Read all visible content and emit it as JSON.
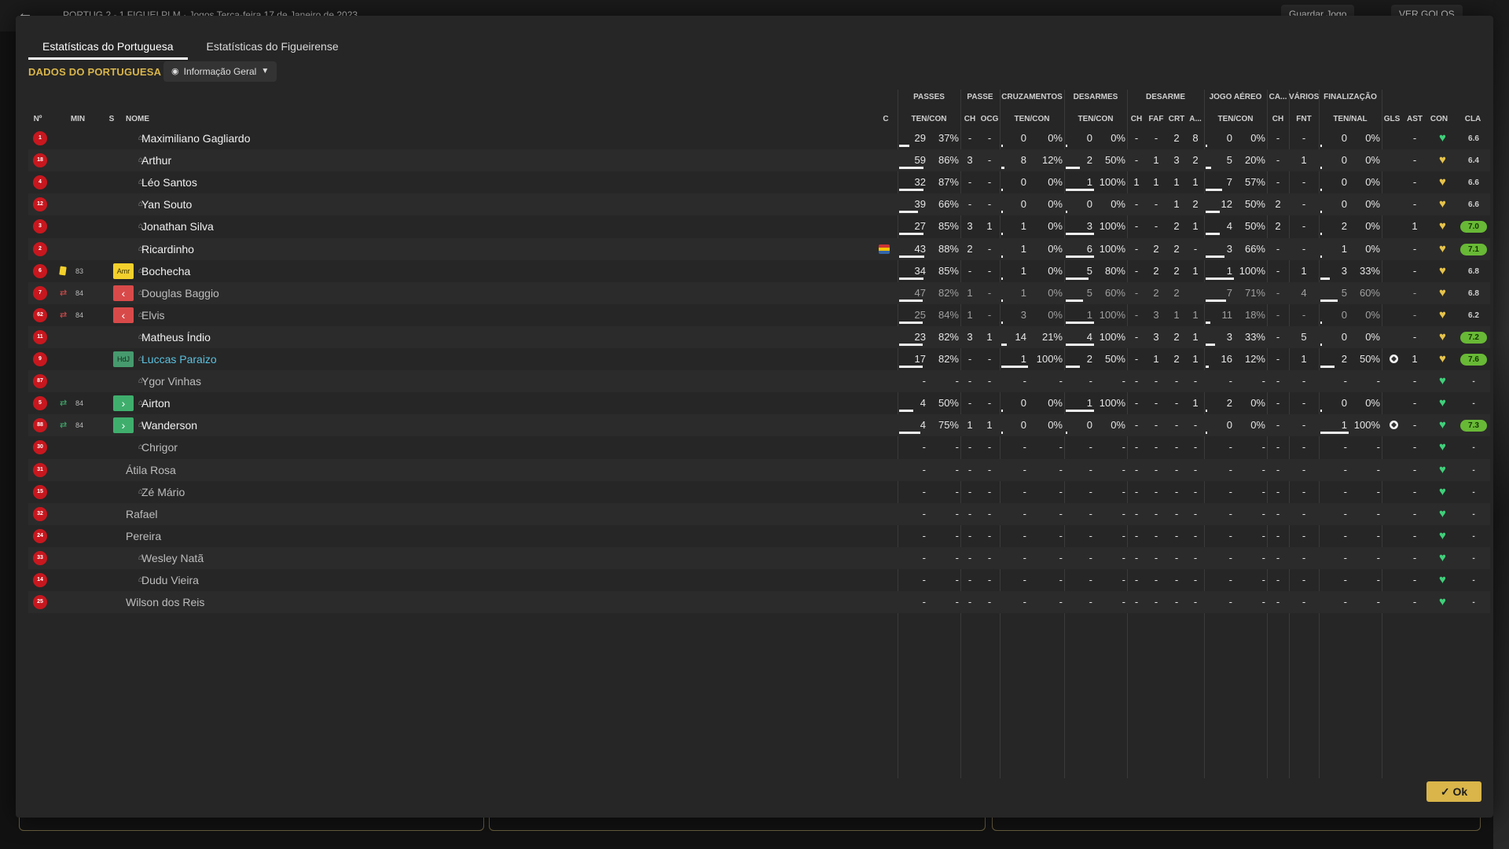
{
  "header": {
    "back_icon": "back-arrow-icon",
    "match_text": "PORTUG  2 - 1  FIGUEI  PLM · Jogos       Terça-feira 17 de Janeiro de 2023",
    "save_label": "Guardar Jogo",
    "goals_label": "VER GOLOS"
  },
  "tabs": [
    {
      "label": "Estatísticas do Portuguesa"
    },
    {
      "label": "Estatísticas do Figueirense"
    }
  ],
  "section_title": "DADOS DO PORTUGUESA",
  "dropdown": {
    "label": "Informação Geral",
    "icon": "eye-icon"
  },
  "groups": {
    "passes": "PASSES",
    "passe": "PASSE",
    "cruzamentos": "CRUZAMENTOS",
    "desarmes": "DESARMES",
    "desarme": "DESARME",
    "jogo_aereo": "JOGO AÉREO",
    "ca": "CA...",
    "varios": "VÁRIOS",
    "finalizacao": "FINALIZAÇÃO"
  },
  "columns": {
    "num": "Nº",
    "min": "MIN",
    "s": "S",
    "nome": "NOME",
    "c": "C",
    "passes_tc": "TEN/CON",
    "passe_ch": "CH",
    "passe_ocg": "OCG",
    "cruz_tc": "TEN/CON",
    "des_tc": "TEN/CON",
    "de_ch": "CH",
    "de_faf": "FAF",
    "de_crt": "CRT",
    "de_a": "A...",
    "aer_tc": "TEN/CON",
    "ca_ch": "CH",
    "fnt": "FNT",
    "fin_tn": "TEN/NAL",
    "gls": "GLS",
    "ast": "AST",
    "con": "CON",
    "cla": "CLA"
  },
  "rating_color": "#68b936",
  "players": [
    {
      "num": "1",
      "name": "Maximiliano Gagliardo",
      "ps": "29",
      "psp": "37%",
      "ch": "-",
      "ocg": "-",
      "cr": "0",
      "crp": "0%",
      "ds": "0",
      "dsp": "0%",
      "dch": "-",
      "faf": "-",
      "crt": "2",
      "da": "8",
      "ae": "0",
      "aep": "0%",
      "cach": "-",
      "fnt": "-",
      "fn": "0",
      "fnp": "0%",
      "gls": "",
      "ast": "-",
      "con": "green",
      "cla": "6.6"
    },
    {
      "num": "18",
      "name": "Arthur",
      "ps": "59",
      "psp": "86%",
      "ch": "3",
      "ocg": "-",
      "cr": "8",
      "crp": "12%",
      "ds": "2",
      "dsp": "50%",
      "dch": "-",
      "faf": "1",
      "crt": "3",
      "da": "2",
      "ae": "5",
      "aep": "20%",
      "cach": "-",
      "fnt": "1",
      "fn": "0",
      "fnp": "0%",
      "gls": "",
      "ast": "-",
      "con": "yellow",
      "cla": "6.4"
    },
    {
      "num": "4",
      "name": "Léo Santos",
      "ps": "32",
      "psp": "87%",
      "ch": "-",
      "ocg": "-",
      "cr": "0",
      "crp": "0%",
      "ds": "1",
      "dsp": "100%",
      "dch": "1",
      "faf": "1",
      "crt": "1",
      "da": "1",
      "ae": "7",
      "aep": "57%",
      "cach": "-",
      "fnt": "-",
      "fn": "0",
      "fnp": "0%",
      "gls": "",
      "ast": "-",
      "con": "yellow",
      "cla": "6.6"
    },
    {
      "num": "12",
      "name": "Yan Souto",
      "ps": "39",
      "psp": "66%",
      "ch": "-",
      "ocg": "-",
      "cr": "0",
      "crp": "0%",
      "ds": "0",
      "dsp": "0%",
      "dch": "-",
      "faf": "-",
      "crt": "1",
      "da": "2",
      "ae": "12",
      "aep": "50%",
      "cach": "2",
      "fnt": "-",
      "fn": "0",
      "fnp": "0%",
      "gls": "",
      "ast": "-",
      "con": "yellow",
      "cla": "6.6"
    },
    {
      "num": "3",
      "name": "Jonathan Silva",
      "ps": "27",
      "psp": "85%",
      "ch": "3",
      "ocg": "1",
      "cr": "1",
      "crp": "0%",
      "ds": "3",
      "dsp": "100%",
      "dch": "-",
      "faf": "-",
      "crt": "2",
      "da": "1",
      "ae": "4",
      "aep": "50%",
      "cach": "2",
      "fnt": "-",
      "fn": "2",
      "fnp": "0%",
      "gls": "",
      "ast": "1",
      "con": "yellow",
      "cla": "7.0"
    },
    {
      "num": "2",
      "name": "Ricardinho",
      "ps": "43",
      "psp": "88%",
      "ch": "2",
      "ocg": "-",
      "cr": "1",
      "crp": "0%",
      "ds": "6",
      "dsp": "100%",
      "dch": "-",
      "faf": "2",
      "crt": "2",
      "da": "-",
      "ae": "3",
      "aep": "66%",
      "cach": "-",
      "fnt": "-",
      "fn": "1",
      "fnp": "0%",
      "gls": "",
      "ast": "-",
      "con": "yellow",
      "cla": "7.1",
      "flag": true
    },
    {
      "num": "6",
      "name": "Bochecha",
      "min": "83",
      "badge": "Amr",
      "card": "yellow",
      "ps": "34",
      "psp": "85%",
      "ch": "-",
      "ocg": "-",
      "cr": "1",
      "crp": "0%",
      "ds": "5",
      "dsp": "80%",
      "dch": "-",
      "faf": "2",
      "crt": "2",
      "da": "1",
      "ae": "1",
      "aep": "100%",
      "cach": "-",
      "fnt": "1",
      "fn": "3",
      "fnp": "33%",
      "gls": "",
      "ast": "-",
      "con": "yellow",
      "cla": "6.8"
    },
    {
      "num": "7",
      "name": "Douglas Baggio",
      "min": "84",
      "badge": "‹",
      "sub": "out",
      "ps": "47",
      "psp": "82%",
      "ch": "1",
      "ocg": "-",
      "cr": "1",
      "crp": "0%",
      "ds": "5",
      "dsp": "60%",
      "dch": "-",
      "faf": "2",
      "crt": "2",
      "da": "",
      "ae": "7",
      "aep": "71%",
      "cach": "-",
      "fnt": "4",
      "fn": "5",
      "fnp": "60%",
      "gls": "",
      "ast": "-",
      "con": "yellow",
      "cla": "6.8"
    },
    {
      "num": "62",
      "name": "Elvis",
      "min": "84",
      "badge": "‹",
      "sub": "out",
      "ps": "25",
      "psp": "84%",
      "ch": "1",
      "ocg": "-",
      "cr": "3",
      "crp": "0%",
      "ds": "1",
      "dsp": "100%",
      "dch": "-",
      "faf": "3",
      "crt": "1",
      "da": "1",
      "ae": "11",
      "aep": "18%",
      "cach": "-",
      "fnt": "-",
      "fn": "0",
      "fnp": "0%",
      "gls": "",
      "ast": "-",
      "con": "yellow",
      "cla": "6.2"
    },
    {
      "num": "11",
      "name": "Matheus Índio",
      "ps": "23",
      "psp": "82%",
      "ch": "3",
      "ocg": "1",
      "cr": "14",
      "crp": "21%",
      "ds": "4",
      "dsp": "100%",
      "dch": "-",
      "faf": "3",
      "crt": "2",
      "da": "1",
      "ae": "3",
      "aep": "33%",
      "cach": "-",
      "fnt": "5",
      "fn": "0",
      "fnp": "0%",
      "gls": "",
      "ast": "-",
      "con": "yellow",
      "cla": "7.2"
    },
    {
      "num": "9",
      "name": "Luccas Paraizo",
      "badge": "HdJ",
      "ps": "17",
      "psp": "82%",
      "ch": "-",
      "ocg": "-",
      "cr": "1",
      "crp": "100%",
      "ds": "2",
      "dsp": "50%",
      "dch": "-",
      "faf": "1",
      "crt": "2",
      "da": "1",
      "ae": "16",
      "aep": "12%",
      "cach": "-",
      "fnt": "1",
      "fn": "2",
      "fnp": "50%",
      "gls": "ball",
      "ast": "1",
      "con": "yellow",
      "cla": "7.6"
    },
    {
      "num": "87",
      "name": "Ygor Vinhas",
      "ps": "-",
      "psp": "-",
      "ch": "-",
      "ocg": "-",
      "cr": "-",
      "crp": "-",
      "ds": "-",
      "dsp": "-",
      "dch": "-",
      "faf": "-",
      "crt": "-",
      "da": "-",
      "ae": "-",
      "aep": "-",
      "cach": "-",
      "fnt": "-",
      "fn": "-",
      "fnp": "-",
      "gls": "",
      "ast": "-",
      "con": "green",
      "cla": "-"
    },
    {
      "num": "5",
      "name": "Airton",
      "min": "84",
      "badge": "›",
      "sub": "in",
      "ps": "4",
      "psp": "50%",
      "ch": "-",
      "ocg": "-",
      "cr": "0",
      "crp": "0%",
      "ds": "1",
      "dsp": "100%",
      "dch": "-",
      "faf": "-",
      "crt": "-",
      "da": "1",
      "ae": "2",
      "aep": "0%",
      "cach": "-",
      "fnt": "-",
      "fn": "0",
      "fnp": "0%",
      "gls": "",
      "ast": "-",
      "con": "green",
      "cla": "-"
    },
    {
      "num": "88",
      "name": "Wanderson",
      "min": "84",
      "badge": "›",
      "sub": "in",
      "ps": "4",
      "psp": "75%",
      "ch": "1",
      "ocg": "1",
      "cr": "0",
      "crp": "0%",
      "ds": "0",
      "dsp": "0%",
      "dch": "-",
      "faf": "-",
      "crt": "-",
      "da": "-",
      "ae": "0",
      "aep": "0%",
      "cach": "-",
      "fnt": "-",
      "fn": "1",
      "fnp": "100%",
      "gls": "ball",
      "ast": "-",
      "con": "green",
      "cla": "7.3"
    },
    {
      "num": "30",
      "name": "Chrigor",
      "ps": "-",
      "psp": "-",
      "ch": "-",
      "ocg": "-",
      "cr": "-",
      "crp": "-",
      "ds": "-",
      "dsp": "-",
      "dch": "-",
      "faf": "-",
      "crt": "-",
      "da": "-",
      "ae": "-",
      "aep": "-",
      "cach": "-",
      "fnt": "-",
      "fn": "-",
      "fnp": "-",
      "gls": "",
      "ast": "-",
      "con": "green",
      "cla": "-"
    },
    {
      "num": "31",
      "name": "Átila Rosa",
      "ps": "-",
      "psp": "-",
      "ch": "-",
      "ocg": "-",
      "cr": "-",
      "crp": "-",
      "ds": "-",
      "dsp": "-",
      "dch": "-",
      "faf": "-",
      "crt": "-",
      "da": "-",
      "ae": "-",
      "aep": "-",
      "cach": "-",
      "fnt": "-",
      "fn": "-",
      "fnp": "-",
      "gls": "",
      "ast": "-",
      "con": "green",
      "cla": "-"
    },
    {
      "num": "15",
      "name": "Zé Mário",
      "ps": "-",
      "psp": "-",
      "ch": "-",
      "ocg": "-",
      "cr": "-",
      "crp": "-",
      "ds": "-",
      "dsp": "-",
      "dch": "-",
      "faf": "-",
      "crt": "-",
      "da": "-",
      "ae": "-",
      "aep": "-",
      "cach": "-",
      "fnt": "-",
      "fn": "-",
      "fnp": "-",
      "gls": "",
      "ast": "-",
      "con": "green",
      "cla": "-"
    },
    {
      "num": "32",
      "name": "Rafael",
      "ps": "-",
      "psp": "-",
      "ch": "-",
      "ocg": "-",
      "cr": "-",
      "crp": "-",
      "ds": "-",
      "dsp": "-",
      "dch": "-",
      "faf": "-",
      "crt": "-",
      "da": "-",
      "ae": "-",
      "aep": "-",
      "cach": "-",
      "fnt": "-",
      "fn": "-",
      "fnp": "-",
      "gls": "",
      "ast": "-",
      "con": "green",
      "cla": "-"
    },
    {
      "num": "24",
      "name": "Pereira",
      "ps": "-",
      "psp": "-",
      "ch": "-",
      "ocg": "-",
      "cr": "-",
      "crp": "-",
      "ds": "-",
      "dsp": "-",
      "dch": "-",
      "faf": "-",
      "crt": "-",
      "da": "-",
      "ae": "-",
      "aep": "-",
      "cach": "-",
      "fnt": "-",
      "fn": "-",
      "fnp": "-",
      "gls": "",
      "ast": "-",
      "con": "green",
      "cla": "-"
    },
    {
      "num": "33",
      "name": "Wesley Natã",
      "ps": "-",
      "psp": "-",
      "ch": "-",
      "ocg": "-",
      "cr": "-",
      "crp": "-",
      "ds": "-",
      "dsp": "-",
      "dch": "-",
      "faf": "-",
      "crt": "-",
      "da": "-",
      "ae": "-",
      "aep": "-",
      "cach": "-",
      "fnt": "-",
      "fn": "-",
      "fnp": "-",
      "gls": "",
      "ast": "-",
      "con": "green",
      "cla": "-"
    },
    {
      "num": "14",
      "name": "Dudu Vieira",
      "ps": "-",
      "psp": "-",
      "ch": "-",
      "ocg": "-",
      "cr": "-",
      "crp": "-",
      "ds": "-",
      "dsp": "-",
      "dch": "-",
      "faf": "-",
      "crt": "-",
      "da": "-",
      "ae": "-",
      "aep": "-",
      "cach": "-",
      "fnt": "-",
      "fn": "-",
      "fnp": "-",
      "gls": "",
      "ast": "-",
      "con": "green",
      "cla": "-"
    },
    {
      "num": "25",
      "name": "Wilson dos Reis",
      "ps": "-",
      "psp": "-",
      "ch": "-",
      "ocg": "-",
      "cr": "-",
      "crp": "-",
      "ds": "-",
      "dsp": "-",
      "dch": "-",
      "faf": "-",
      "crt": "-",
      "da": "-",
      "ae": "-",
      "aep": "-",
      "cach": "-",
      "fnt": "-",
      "fn": "-",
      "fnp": "-",
      "gls": "",
      "ast": "-",
      "con": "green",
      "cla": "-"
    }
  ],
  "ok_label": "Ok"
}
